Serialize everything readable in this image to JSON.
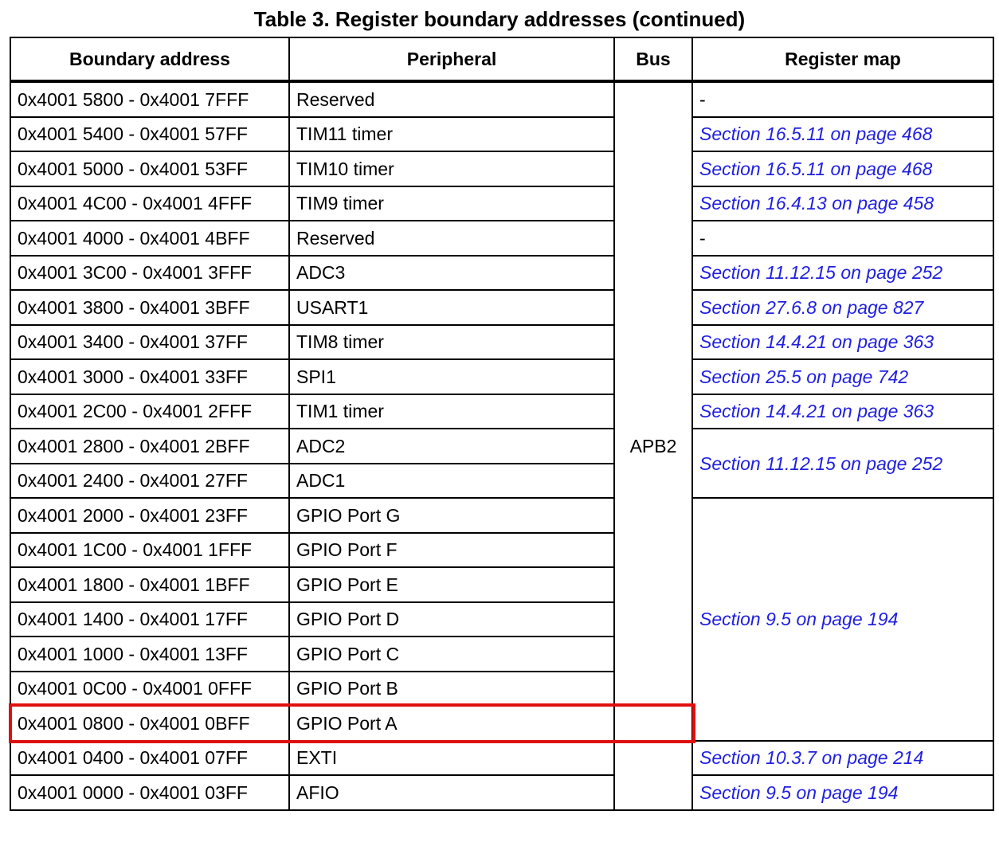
{
  "title": "Table 3. Register boundary addresses (continued)",
  "headers": {
    "boundary": "Boundary address",
    "peripheral": "Peripheral",
    "bus": "Bus",
    "register_map": "Register map"
  },
  "bus_value": "APB2",
  "rows": [
    {
      "address": "0x4001 5800 - 0x4001 7FFF",
      "peripheral": "Reserved"
    },
    {
      "address": "0x4001 5400 - 0x4001 57FF",
      "peripheral": "TIM11 timer"
    },
    {
      "address": "0x4001 5000 - 0x4001 53FF",
      "peripheral": "TIM10 timer"
    },
    {
      "address": "0x4001 4C00 - 0x4001 4FFF",
      "peripheral": "TIM9 timer"
    },
    {
      "address": "0x4001 4000 - 0x4001 4BFF",
      "peripheral": "Reserved"
    },
    {
      "address": "0x4001 3C00 - 0x4001 3FFF",
      "peripheral": "ADC3"
    },
    {
      "address": "0x4001 3800 - 0x4001 3BFF",
      "peripheral": "USART1"
    },
    {
      "address": "0x4001 3400 - 0x4001 37FF",
      "peripheral": "TIM8 timer"
    },
    {
      "address": "0x4001 3000 - 0x4001 33FF",
      "peripheral": "SPI1"
    },
    {
      "address": "0x4001 2C00 - 0x4001 2FFF",
      "peripheral": "TIM1 timer"
    },
    {
      "address": "0x4001 2800 - 0x4001 2BFF",
      "peripheral": "ADC2"
    },
    {
      "address": "0x4001 2400 - 0x4001 27FF",
      "peripheral": "ADC1"
    },
    {
      "address": "0x4001 2000 - 0x4001 23FF",
      "peripheral": "GPIO Port G"
    },
    {
      "address": "0x4001 1C00 - 0x4001 1FFF",
      "peripheral": "GPIO Port F"
    },
    {
      "address": "0x4001 1800 - 0x4001 1BFF",
      "peripheral": "GPIO Port E"
    },
    {
      "address": "0x4001 1400 - 0x4001 17FF",
      "peripheral": "GPIO Port D"
    },
    {
      "address": "0x4001 1000 - 0x4001 13FF",
      "peripheral": "GPIO Port C"
    },
    {
      "address": "0x4001 0C00 - 0x4001 0FFF",
      "peripheral": "GPIO Port B"
    },
    {
      "address": "0x4001 0800 - 0x4001 0BFF",
      "peripheral": "GPIO Port A"
    },
    {
      "address": "0x4001 0400 - 0x4001 07FF",
      "peripheral": "EXTI"
    },
    {
      "address": "0x4001 0000 - 0x4001 03FF",
      "peripheral": "AFIO"
    }
  ],
  "register_map": [
    "-",
    "Section 16.5.11 on page 468",
    "Section 16.5.11 on page 468",
    "Section 16.4.13 on page 458",
    "-",
    "Section 11.12.15 on page 252",
    "Section 27.6.8 on page 827",
    "Section 14.4.21 on page 363",
    "Section 25.5 on page 742",
    "Section 14.4.21 on page 363",
    "Section 11.12.15 on page 252",
    "Section 9.5 on page 194",
    "Section 10.3.7 on page 214",
    "Section 9.5 on page 194"
  ],
  "highlighted_row": "GPIO Port A",
  "colors": {
    "link": "#1f1fe0",
    "highlight": "#e01010"
  }
}
